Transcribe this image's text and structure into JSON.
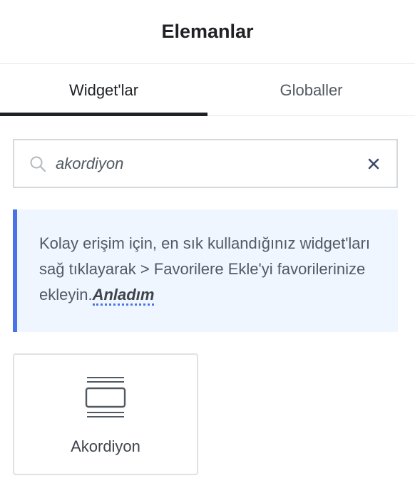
{
  "header": {
    "title": "Elemanlar"
  },
  "tabs": [
    {
      "label": "Widget'lar",
      "active": true
    },
    {
      "label": "Globaller",
      "active": false
    }
  ],
  "search": {
    "value": "akordiyon",
    "icon": "search-icon",
    "clear_icon": "close-icon"
  },
  "notice": {
    "text": "Kolay erişim için, en sık kullandığınız widget'ları sağ tıklayarak > Favorilere Ekle'yi favorilerinize ekleyin.",
    "link_label": "Anladım",
    "accent_color": "#4a74e6"
  },
  "widgets": [
    {
      "label": "Akordiyon",
      "icon": "accordion-icon"
    }
  ]
}
